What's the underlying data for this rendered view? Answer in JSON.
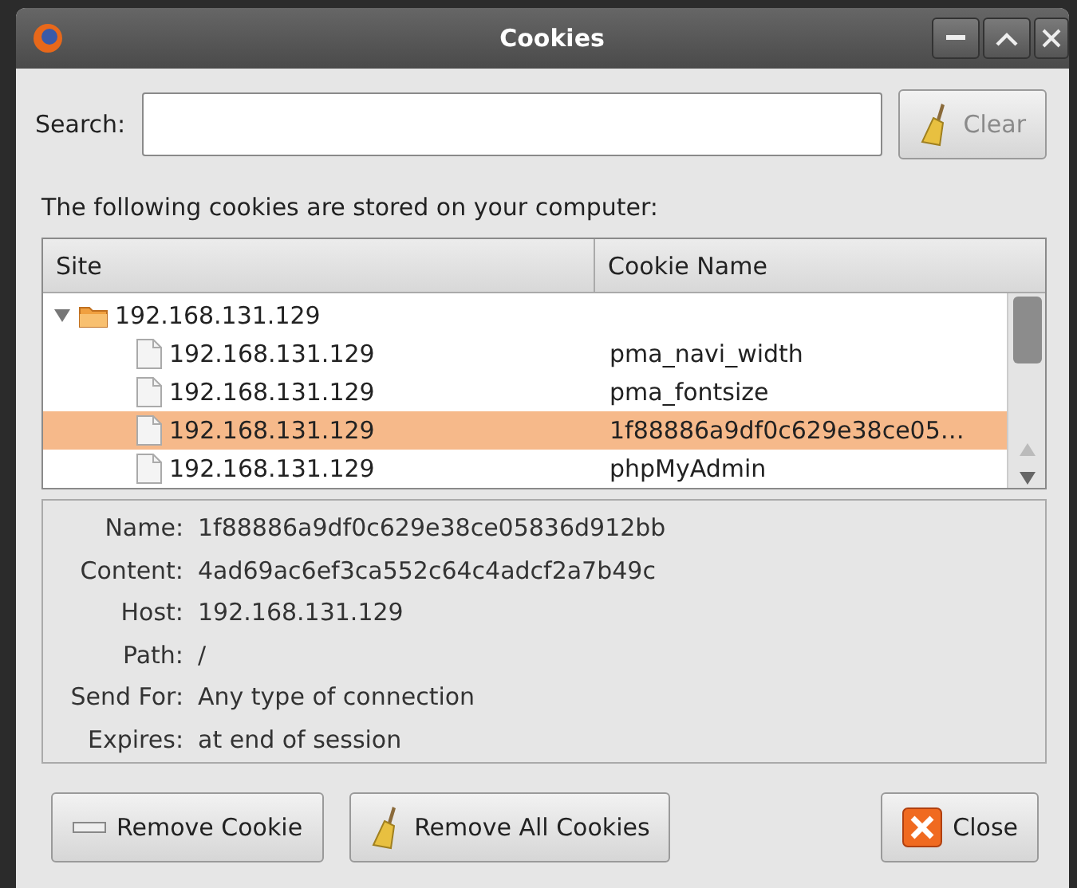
{
  "window": {
    "title": "Cookies"
  },
  "search": {
    "label": "Search:",
    "clear_button": {
      "label": "Clear",
      "disabled": true
    }
  },
  "description": "The following cookies are stored on your computer:",
  "table": {
    "columns": [
      "Site",
      "Cookie Name"
    ],
    "rows": [
      {
        "site": "192.168.131.129",
        "expanded": true,
        "selected": false,
        "children": [
          {
            "site": "192.168.131.129",
            "cookie_name": "pma_navi_width",
            "selected": false
          },
          {
            "site": "192.168.131.129",
            "cookie_name": "pma_fontsize",
            "selected": false
          },
          {
            "site": "192.168.131.129",
            "cookie_name": "1f88886a9df0c629e38ce05…",
            "selected": true
          },
          {
            "site": "192.168.131.129",
            "cookie_name": "phpMyAdmin",
            "selected": false
          }
        ]
      }
    ]
  },
  "details": [
    {
      "label": "Name:",
      "value": "1f88886a9df0c629e38ce05836d912bb"
    },
    {
      "label": "Content:",
      "value": "4ad69ac6ef3ca552c64c4adcf2a7b49c"
    },
    {
      "label": "Host:",
      "value": "192.168.131.129"
    },
    {
      "label": "Path:",
      "value": "/"
    },
    {
      "label": "Send For:",
      "value": "Any type of connection"
    },
    {
      "label": "Expires:",
      "value": "at end of session"
    }
  ],
  "buttons": [
    {
      "kind": "remove",
      "label": "Remove Cookie"
    },
    {
      "kind": "remove_all",
      "label": "Remove All Cookies"
    },
    {
      "kind": "close",
      "label": "Close"
    }
  ]
}
